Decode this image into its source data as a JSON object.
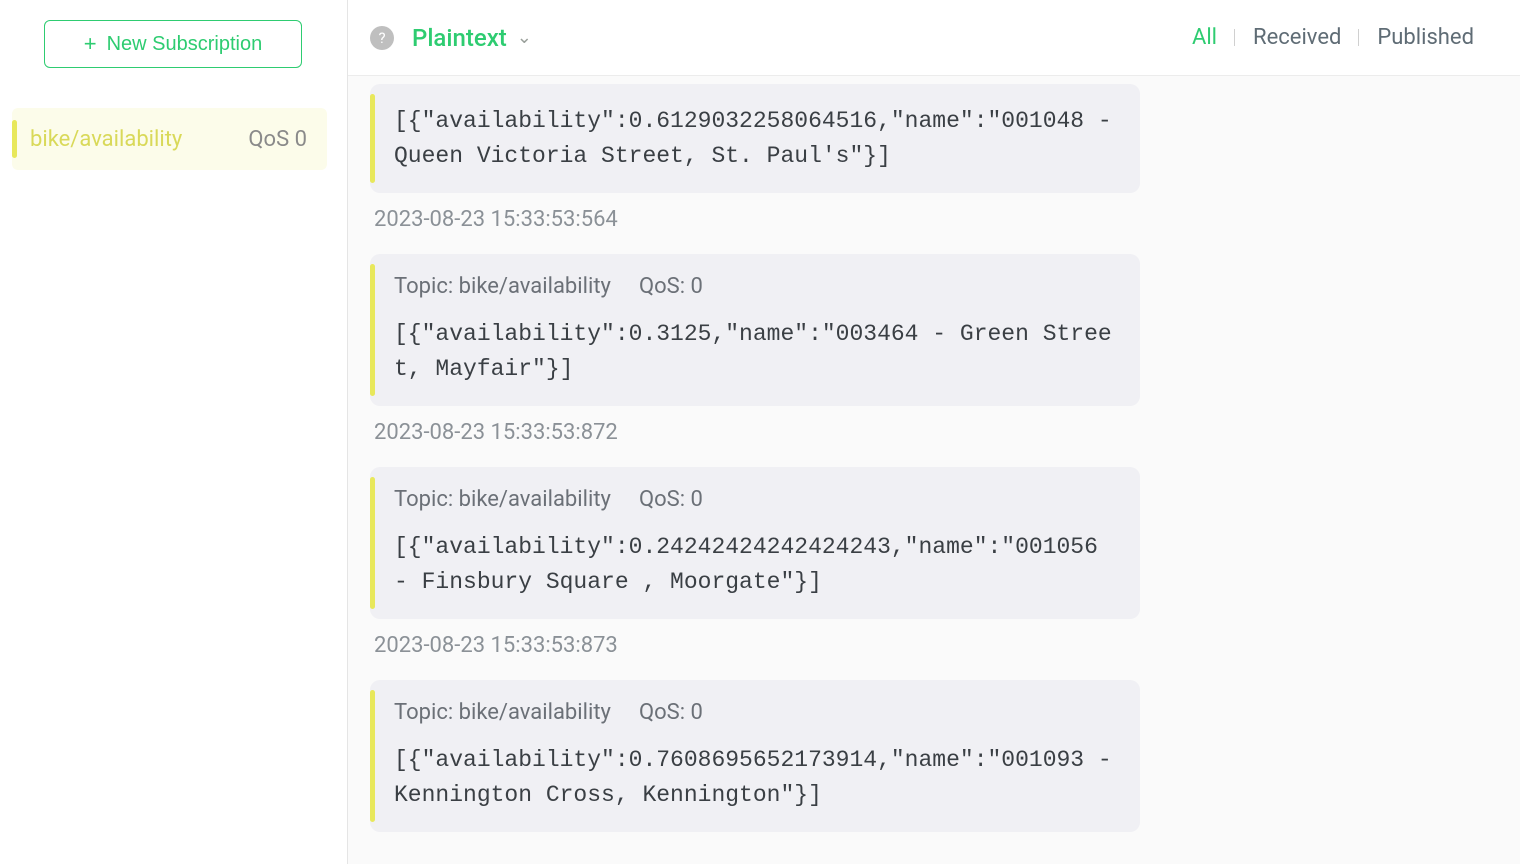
{
  "sidebar": {
    "new_subscription_label": "New Subscription",
    "subscriptions": [
      {
        "topic": "bike/availability",
        "qos": "QoS 0"
      }
    ]
  },
  "topbar": {
    "format_label": "Plaintext",
    "tabs": {
      "all": "All",
      "received": "Received",
      "published": "Published"
    }
  },
  "labels": {
    "topic_prefix": "Topic: ",
    "qos_prefix": "QoS: "
  },
  "messages": [
    {
      "show_header": false,
      "topic": "bike/availability",
      "qos": "0",
      "body": "[{\"availability\":0.6129032258064516,\"name\":\"001048 - Queen Victoria Street, St. Paul's\"}]",
      "timestamp": "2023-08-23 15:33:53:564"
    },
    {
      "show_header": true,
      "topic": "bike/availability",
      "qos": "0",
      "body": "[{\"availability\":0.3125,\"name\":\"003464 - Green Street, Mayfair\"}]",
      "timestamp": "2023-08-23 15:33:53:872"
    },
    {
      "show_header": true,
      "topic": "bike/availability",
      "qos": "0",
      "body": "[{\"availability\":0.24242424242424243,\"name\":\"001056 - Finsbury Square , Moorgate\"}]",
      "timestamp": "2023-08-23 15:33:53:873"
    },
    {
      "show_header": true,
      "topic": "bike/availability",
      "qos": "0",
      "body": "[{\"availability\":0.7608695652173914,\"name\":\"001093 - Kennington Cross, Kennington\"}]",
      "timestamp": ""
    }
  ]
}
